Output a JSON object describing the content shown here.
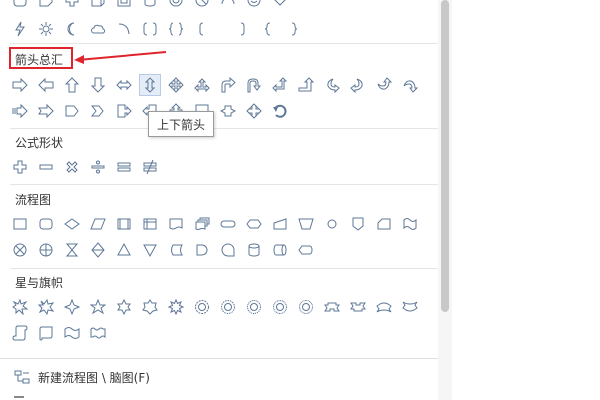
{
  "sections": [
    {
      "key": "arrows",
      "label": "箭头总汇"
    },
    {
      "key": "formula",
      "label": "公式形状"
    },
    {
      "key": "flowchart",
      "label": "流程图"
    },
    {
      "key": "stars",
      "label": "星与旗帜"
    }
  ],
  "tooltip": {
    "text": "上下箭头"
  },
  "footer": {
    "new_flowchart_label": "新建流程图 \\ 脑图(F)"
  },
  "icon_names": {
    "top_row_1": [
      "rounded-rect",
      "folded-corner",
      "plus",
      "cube",
      "bevel",
      "can",
      "donut",
      "no-symbol",
      "block-arc",
      "smiley",
      "heart"
    ],
    "top_row_2": [
      "lightning",
      "sun",
      "moon",
      "cloud",
      "arc",
      "bracket-pair",
      "brace-pair",
      "left-bracket",
      "right-bracket",
      "left-brace",
      "right-brace"
    ],
    "arrows_row_1": [
      "right-arrow",
      "left-arrow",
      "up-arrow",
      "down-arrow",
      "left-right-arrow",
      "up-down-arrow",
      "quad-arrow",
      "left-right-up-arrow",
      "bent-arrow",
      "u-turn-arrow",
      "left-up-arrow",
      "bent-up-arrow",
      "curved-right-arrow",
      "curved-left-arrow",
      "curved-up-arrow",
      "curved-down-arrow"
    ],
    "arrows_row_2": [
      "striped-right-arrow",
      "notched-right-arrow",
      "pentagon-arrow",
      "chevron-arrow",
      "right-arrow-callout",
      "left-arrow-callout",
      "up-arrow-callout",
      "down-arrow-callout",
      "left-right-arrow-callout",
      "quad-arrow-callout",
      "circular-arrow"
    ],
    "formula": [
      "plus-sign",
      "minus-sign",
      "multiply-sign",
      "divide-sign",
      "equal-sign",
      "not-equal-sign"
    ],
    "flow_row_1": [
      "process",
      "alternate-process",
      "decision",
      "data",
      "predefined-process",
      "internal-storage",
      "document",
      "multidocument",
      "terminator",
      "preparation",
      "manual-input",
      "manual-operation",
      "connector",
      "off-page-connector",
      "card",
      "punched-tape"
    ],
    "flow_row_2": [
      "summing-junction",
      "or",
      "collate",
      "sort",
      "extract",
      "merge",
      "stored-data",
      "delay",
      "sequential-storage",
      "magnetic-disk",
      "direct-access-storage",
      "display"
    ],
    "stars_row_1": [
      "explosion-1",
      "explosion-2",
      "4-point-star",
      "5-point-star",
      "6-point-star",
      "7-point-star",
      "8-point-star",
      "10-point-star",
      "12-point-star",
      "16-point-star",
      "24-point-star",
      "32-point-star",
      "up-ribbon",
      "down-ribbon",
      "curved-up-ribbon",
      "curved-down-ribbon"
    ],
    "stars_row_2": [
      "vertical-scroll",
      "horizontal-scroll",
      "wave",
      "double-wave"
    ]
  },
  "colors": {
    "icon": "#5e7796",
    "highlight": "#e0242b",
    "hover_bg": "#e4ecf7"
  }
}
